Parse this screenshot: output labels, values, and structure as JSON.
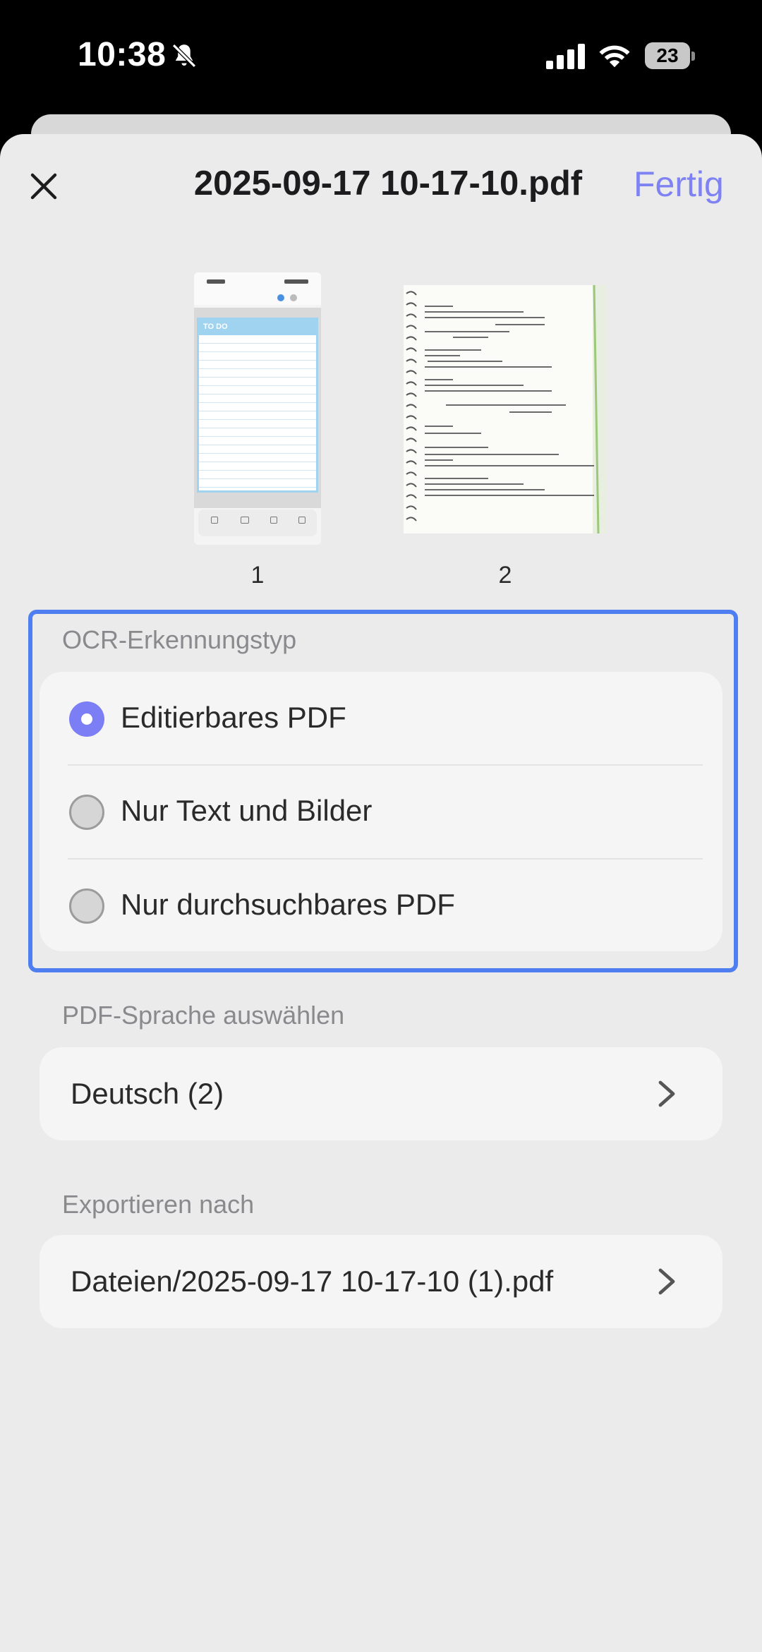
{
  "status_bar": {
    "time": "10:38",
    "battery": "23",
    "icons": [
      "bell-slash-icon",
      "cellular-signal-icon",
      "wifi-icon",
      "battery-icon"
    ]
  },
  "header": {
    "title": "2025-09-17 10-17-10.pdf",
    "done_label": "Fertig",
    "accent_color": "#7f82f2"
  },
  "pages": [
    {
      "number": "1",
      "thumb_heading": "TO DO"
    },
    {
      "number": "2"
    }
  ],
  "ocr": {
    "label": "OCR-Erkennungstyp",
    "highlight_color": "#4f7ef0",
    "options": [
      {
        "label": "Editierbares PDF",
        "selected": true
      },
      {
        "label": "Nur Text und Bilder",
        "selected": false
      },
      {
        "label": "Nur durchsuchbares PDF",
        "selected": false
      }
    ]
  },
  "language": {
    "label": "PDF-Sprache auswählen",
    "value": "Deutsch (2)"
  },
  "export": {
    "label": "Exportieren nach",
    "value": "Dateien/2025-09-17 10-17-10 (1).pdf"
  }
}
